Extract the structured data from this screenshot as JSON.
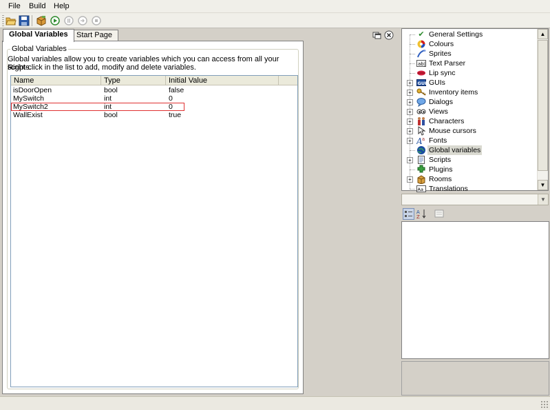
{
  "menu": {
    "items": [
      "File",
      "Build",
      "Help"
    ]
  },
  "toolbar": {
    "buttons": [
      "open-folder-icon",
      "save-icon",
      "package-icon",
      "run-icon",
      "pause-icon",
      "step-icon",
      "stop-icon"
    ]
  },
  "tabs": [
    {
      "label": "Global Variables",
      "active": true
    },
    {
      "label": "Start Page",
      "active": false
    }
  ],
  "panel": {
    "group_title": "Global Variables",
    "description_line1": "Global variables allow you to create variables which you can access from all your scripts.",
    "description_line2": "Right-click in the list to add, modify and delete variables."
  },
  "list": {
    "columns": [
      "Name",
      "Type",
      "Initial Value"
    ],
    "rows": [
      {
        "name": "isDoorOpen",
        "type": "bool",
        "value": "false"
      },
      {
        "name": "MySwitch",
        "type": "int",
        "value": "0"
      },
      {
        "name": "MySwitch2",
        "type": "int",
        "value": "0"
      },
      {
        "name": "WallExist",
        "type": "bool",
        "value": "true"
      }
    ]
  },
  "tree": {
    "items": [
      {
        "label": "General Settings",
        "icon": "checkmark-icon",
        "expandable": false
      },
      {
        "label": "Colours",
        "icon": "palette-icon",
        "expandable": false
      },
      {
        "label": "Sprites",
        "icon": "sprites-icon",
        "expandable": false
      },
      {
        "label": "Text Parser",
        "icon": "text-parser-icon",
        "expandable": false
      },
      {
        "label": "Lip sync",
        "icon": "lips-icon",
        "expandable": false
      },
      {
        "label": "GUIs",
        "icon": "gui-icon",
        "expandable": true
      },
      {
        "label": "Inventory items",
        "icon": "key-icon",
        "expandable": true
      },
      {
        "label": "Dialogs",
        "icon": "speech-bubble-icon",
        "expandable": true
      },
      {
        "label": "Views",
        "icon": "eyes-icon",
        "expandable": true
      },
      {
        "label": "Characters",
        "icon": "people-icon",
        "expandable": true
      },
      {
        "label": "Mouse cursors",
        "icon": "cursor-icon",
        "expandable": true
      },
      {
        "label": "Fonts",
        "icon": "font-icon",
        "expandable": true
      },
      {
        "label": "Global variables",
        "icon": "globe-icon",
        "expandable": false,
        "selected": true
      },
      {
        "label": "Scripts",
        "icon": "script-icon",
        "expandable": true
      },
      {
        "label": "Plugins",
        "icon": "plugin-icon",
        "expandable": false
      },
      {
        "label": "Rooms",
        "icon": "room-icon",
        "expandable": true
      },
      {
        "label": "Translations",
        "icon": "translation-icon",
        "expandable": false
      }
    ]
  },
  "properties": {
    "toolbar": [
      "categorized-icon",
      "alphabetical-icon",
      "property-pages-icon"
    ]
  },
  "colors": {
    "selection_outline": "#e03030",
    "tree_selected": "#d9d9d0",
    "chrome": "#d4d0c8"
  }
}
